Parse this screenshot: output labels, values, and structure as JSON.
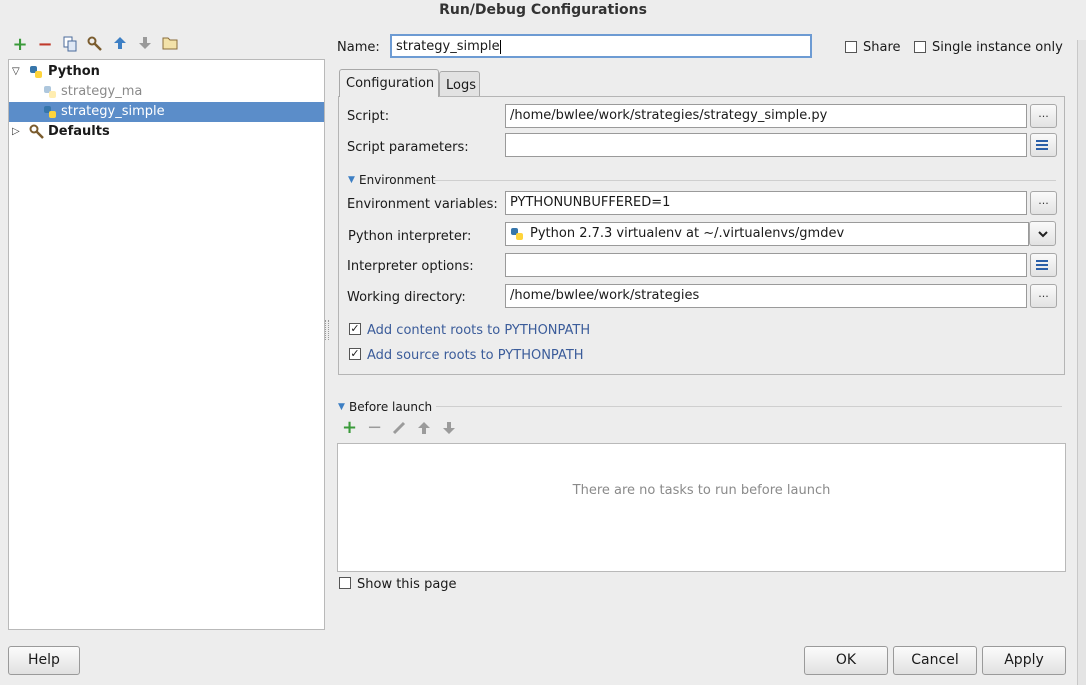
{
  "window": {
    "title": "Run/Debug Configurations"
  },
  "toolbar": {
    "icons": [
      "add-icon",
      "remove-icon",
      "copy-icon",
      "edit-defaults-icon",
      "move-up-icon",
      "move-down-icon",
      "folder-icon"
    ]
  },
  "tree": {
    "items": [
      {
        "label": "Python",
        "level": 0,
        "expanded": true,
        "bold": true
      },
      {
        "label": "strategy_ma",
        "level": 1,
        "dim": true
      },
      {
        "label": "strategy_simple",
        "level": 1,
        "selected": true
      },
      {
        "label": "Defaults",
        "level": 0,
        "expanded": false,
        "bold": true
      }
    ]
  },
  "header": {
    "name_label": "Name:",
    "name_value": "strategy_simple",
    "share_label": "Share",
    "single_instance_label": "Single instance only"
  },
  "tabs": [
    {
      "label": "Configuration",
      "active": true
    },
    {
      "label": "Logs",
      "active": false
    }
  ],
  "config": {
    "script_label": "Script:",
    "script_value": "/home/bwlee/work/strategies/strategy_simple.py",
    "params_label": "Script parameters:",
    "params_value": "",
    "environment_section": "Environment",
    "env_vars_label": "Environment variables:",
    "env_vars_value": "PYTHONUNBUFFERED=1",
    "interpreter_label": "Python interpreter:",
    "interpreter_value": "Python 2.7.3 virtualenv at ~/.virtualenvs/gmdev",
    "interp_options_label": "Interpreter options:",
    "interp_options_value": "",
    "workdir_label": "Working directory:",
    "workdir_value": "/home/bwlee/work/strategies",
    "content_roots_label": "Add content roots to PYTHONPATH",
    "content_roots_checked": true,
    "source_roots_label": "Add source roots to PYTHONPATH",
    "source_roots_checked": true,
    "browse_label": "..."
  },
  "before_launch": {
    "section_label": "Before launch",
    "empty_text": "There are no tasks to run before launch",
    "show_page_label": "Show this page"
  },
  "buttons": {
    "help": "Help",
    "ok": "OK",
    "cancel": "Cancel",
    "apply": "Apply"
  },
  "colors": {
    "selection": "#5b8dc9",
    "add_green": "#3a9a3a",
    "remove_red": "#c0392b",
    "arrow_blue": "#3d7fc4",
    "link_blue": "#3b5c9a"
  }
}
